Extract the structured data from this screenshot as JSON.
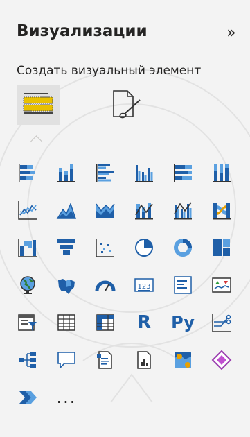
{
  "panel": {
    "title": "Визуализации",
    "collapse_glyph": "»",
    "subtitle": "Создать визуальный элемент"
  },
  "tabs": [
    {
      "name": "build-visual-tab",
      "icon": "table-fields-icon",
      "active": true
    },
    {
      "name": "format-visual-tab",
      "icon": "format-page-brush-icon",
      "active": false
    }
  ],
  "visuals": [
    {
      "name": "stacked-bar-chart",
      "icon": "stacked-bar-icon"
    },
    {
      "name": "stacked-column-chart",
      "icon": "stacked-column-icon"
    },
    {
      "name": "clustered-bar-chart",
      "icon": "clustered-bar-icon"
    },
    {
      "name": "clustered-column-chart",
      "icon": "clustered-column-icon"
    },
    {
      "name": "100-stacked-bar-chart",
      "icon": "full-stacked-bar-icon"
    },
    {
      "name": "100-stacked-column-chart",
      "icon": "full-stacked-column-icon"
    },
    {
      "name": "line-chart",
      "icon": "line-chart-icon"
    },
    {
      "name": "area-chart",
      "icon": "area-chart-icon"
    },
    {
      "name": "stacked-area-chart",
      "icon": "stacked-area-icon"
    },
    {
      "name": "line-and-stacked-column-chart",
      "icon": "line-stacked-column-icon"
    },
    {
      "name": "line-and-clustered-column-chart",
      "icon": "line-clustered-column-icon"
    },
    {
      "name": "ribbon-chart",
      "icon": "ribbon-chart-icon"
    },
    {
      "name": "waterfall-chart",
      "icon": "waterfall-icon"
    },
    {
      "name": "funnel-chart",
      "icon": "funnel-icon"
    },
    {
      "name": "scatter-chart",
      "icon": "scatter-icon"
    },
    {
      "name": "pie-chart",
      "icon": "pie-chart-icon"
    },
    {
      "name": "donut-chart",
      "icon": "donut-chart-icon"
    },
    {
      "name": "treemap",
      "icon": "treemap-icon"
    },
    {
      "name": "map",
      "icon": "globe-map-icon"
    },
    {
      "name": "filled-map",
      "icon": "filled-map-icon"
    },
    {
      "name": "gauge",
      "icon": "gauge-icon"
    },
    {
      "name": "card",
      "icon": "card-123-icon",
      "label": "123"
    },
    {
      "name": "multi-row-card",
      "icon": "multi-row-card-icon"
    },
    {
      "name": "kpi",
      "icon": "kpi-icon"
    },
    {
      "name": "slicer",
      "icon": "slicer-icon"
    },
    {
      "name": "table",
      "icon": "table-icon"
    },
    {
      "name": "matrix",
      "icon": "matrix-icon"
    },
    {
      "name": "r-script-visual",
      "icon": "r-icon",
      "label": "R"
    },
    {
      "name": "python-visual",
      "icon": "python-icon",
      "label": "Py"
    },
    {
      "name": "key-influencers",
      "icon": "key-influencers-icon"
    },
    {
      "name": "decomposition-tree",
      "icon": "decomposition-tree-icon"
    },
    {
      "name": "q-and-a",
      "icon": "speech-bubble-icon"
    },
    {
      "name": "smart-narrative",
      "icon": "narrative-document-icon"
    },
    {
      "name": "paginated-report",
      "icon": "paginated-report-icon"
    },
    {
      "name": "azure-map",
      "icon": "azure-map-icon"
    },
    {
      "name": "power-apps",
      "icon": "power-apps-icon"
    },
    {
      "name": "power-automate",
      "icon": "power-automate-icon"
    }
  ],
  "more_label": "...",
  "colors": {
    "accent_blue": "#1f5fa8",
    "light_blue": "#5aa0e0",
    "yellow": "#e8c000",
    "panel_bg": "#f3f3f3"
  }
}
